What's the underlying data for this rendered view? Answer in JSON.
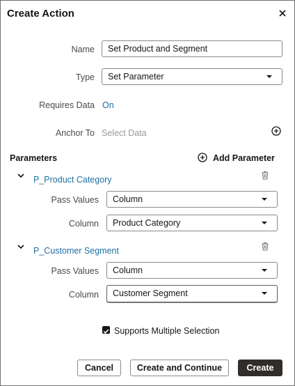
{
  "dialog": {
    "title": "Create Action",
    "close_icon": "close-icon"
  },
  "form": {
    "name_label": "Name",
    "name_value": "Set Product and Segment",
    "type_label": "Type",
    "type_value": "Set Parameter",
    "requires_data_label": "Requires Data",
    "requires_data_value": "On",
    "anchor_label": "Anchor To",
    "anchor_placeholder": "Select Data"
  },
  "parameters": {
    "heading": "Parameters",
    "add_label": "Add Parameter",
    "items": [
      {
        "name": "P_Product Category",
        "pass_values_label": "Pass Values",
        "pass_values_value": "Column",
        "column_label": "Column",
        "column_value": "Product Category"
      },
      {
        "name": "P_Customer Segment",
        "pass_values_label": "Pass Values",
        "pass_values_value": "Column",
        "column_label": "Column",
        "column_value": "Customer Segment"
      }
    ]
  },
  "options": {
    "multiple_selection_label": "Supports Multiple Selection",
    "multiple_selection_checked": true
  },
  "footer": {
    "cancel_label": "Cancel",
    "create_continue_label": "Create and Continue",
    "create_label": "Create"
  },
  "colors": {
    "link": "#1d6fa3",
    "primary_button": "#312d2a",
    "text": "#161513"
  }
}
